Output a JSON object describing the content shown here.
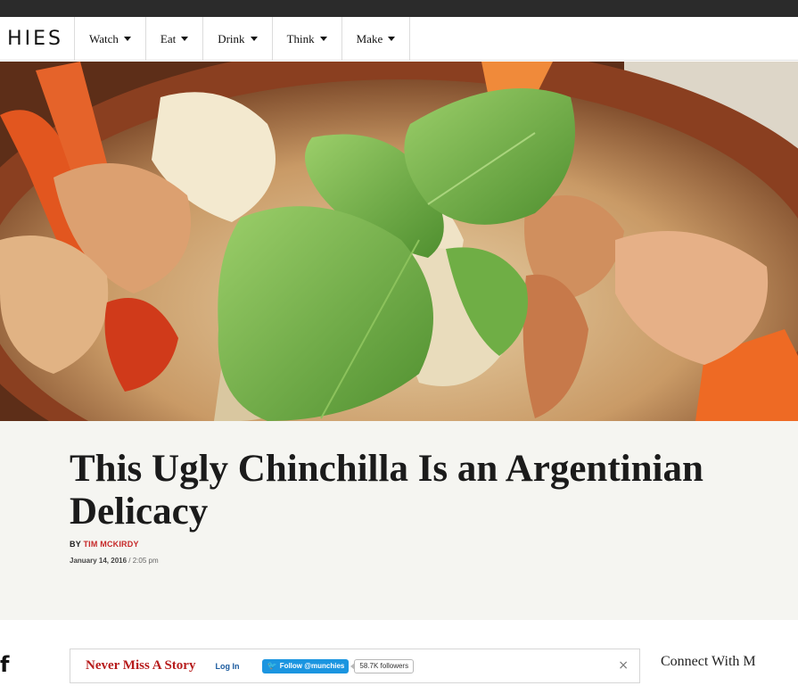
{
  "header": {
    "logo_text": "HIES",
    "nav": [
      {
        "label": "Watch"
      },
      {
        "label": "Eat"
      },
      {
        "label": "Drink"
      },
      {
        "label": "Think"
      },
      {
        "label": "Make"
      }
    ]
  },
  "article": {
    "title": "This Ugly Chinchilla Is an Argentinian Delicacy",
    "byline_prefix": "BY",
    "author": "TIM MCKIRDY",
    "date": "January 14, 2016",
    "time_separator": " / ",
    "time": "2:05 pm"
  },
  "sidebar": {
    "facebook_glyph": "f"
  },
  "subscribe": {
    "title": "Never Miss A Story",
    "login": "Log In",
    "follow_label": "Follow @munchies",
    "followers": "58.7K followers",
    "close": "×"
  },
  "connect": {
    "title": "Connect With M"
  },
  "colors": {
    "accent_red": "#b71c1c",
    "twitter_blue": "#1b95e0",
    "headline_bg": "#f5f5f1"
  }
}
